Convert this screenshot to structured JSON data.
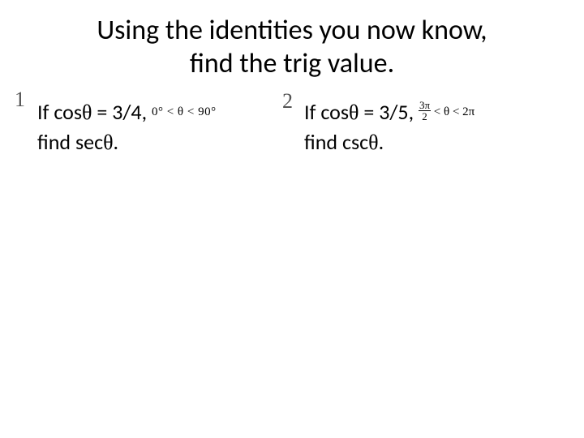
{
  "title_line1": "Using the identities you now know,",
  "title_line2": "find the trig value.",
  "problems": [
    {
      "number": "1",
      "line1_pre": "If cos",
      "theta": "θ",
      "line1_mid": " = 3/4, ",
      "condition": "0° < θ < 90°",
      "line2_pre": "find sec",
      "line2_post": "."
    },
    {
      "number": "2",
      "line1_pre": "If cos",
      "theta": "θ",
      "line1_mid": " = 3/5, ",
      "cond_frac_top": "3π",
      "cond_frac_bot": "2",
      "cond_mid": " < θ < 2π",
      "line2_pre": "find csc",
      "line2_post": "."
    }
  ]
}
